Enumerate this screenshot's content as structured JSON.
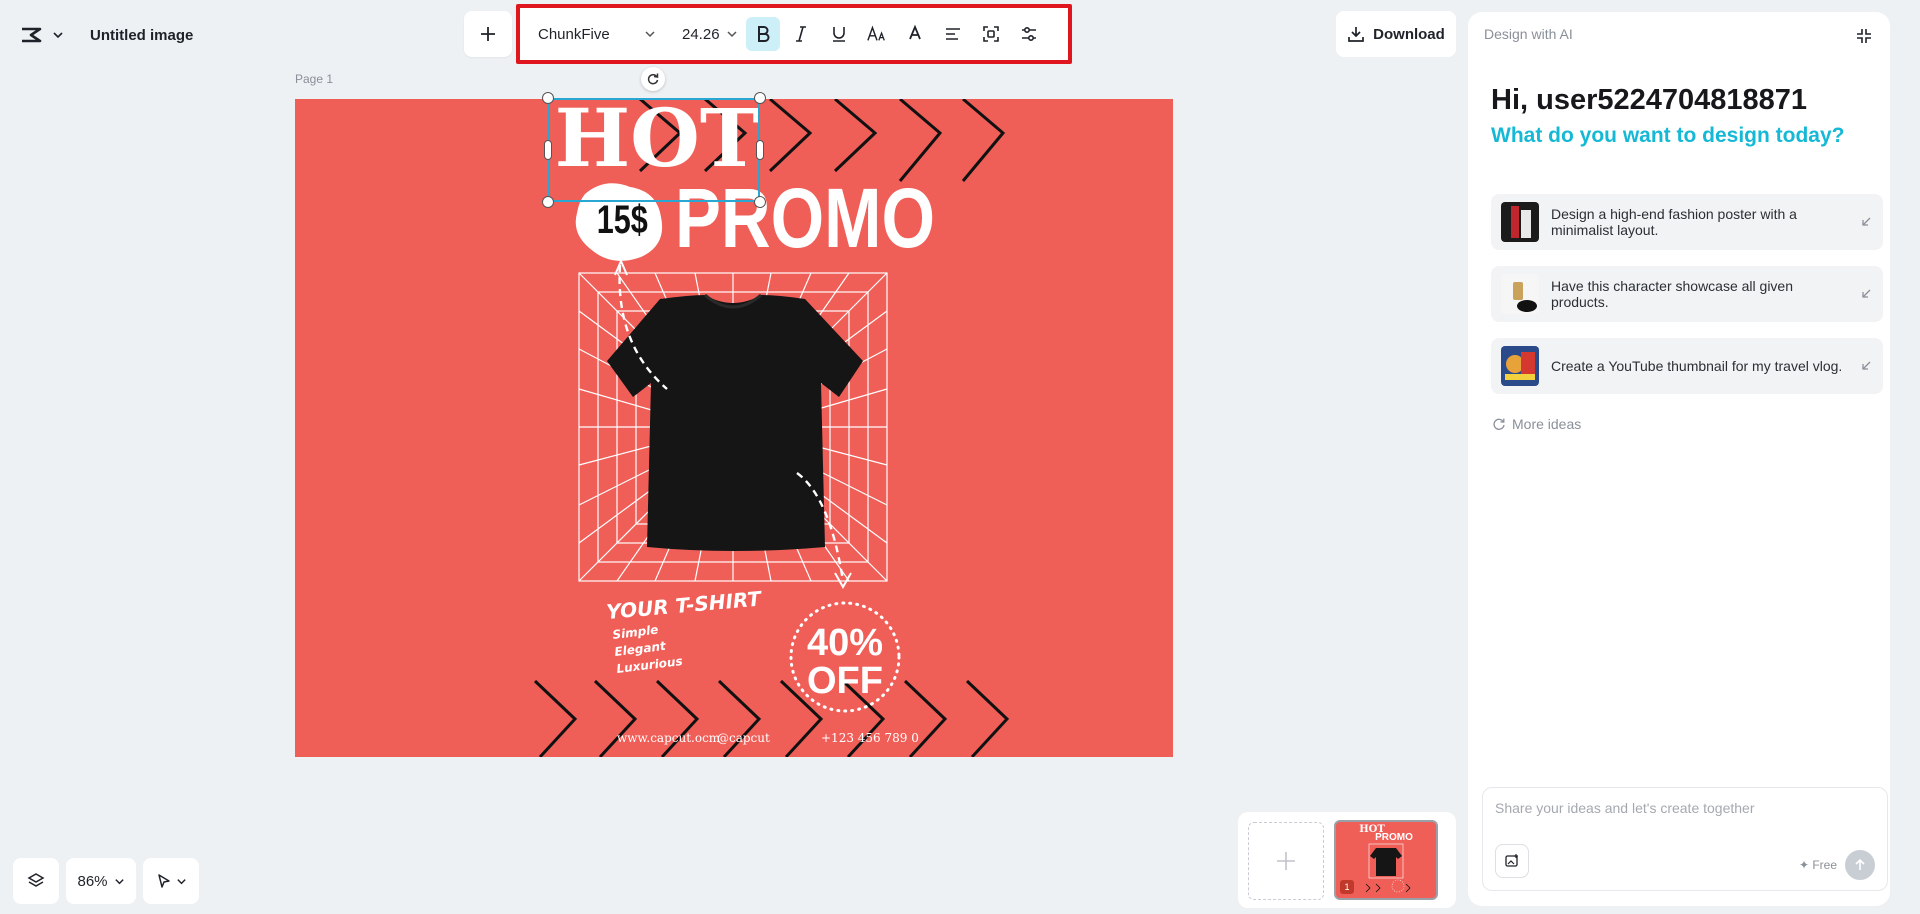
{
  "header": {
    "title": "Untitled image",
    "download_label": "Download"
  },
  "toolbar": {
    "font_name": "ChunkFive",
    "font_size": "24.26",
    "bold_active": true
  },
  "canvas": {
    "page_label": "Page 1",
    "poster": {
      "headline_1": "HOT",
      "headline_2": "PROMO",
      "price_badge": "15$",
      "tagline": "YOUR T-SHIRT",
      "features": [
        "Simple",
        "Elegant",
        "Luxurious"
      ],
      "discount_line_1": "40%",
      "discount_line_2": "OFF",
      "website": "www.capcut.ocm",
      "handle": "@capcut",
      "phone": "+123 456 789 0",
      "background_color": "#f05e58"
    }
  },
  "bottom_controls": {
    "zoom": "86%",
    "page_number": "1"
  },
  "panel": {
    "header": "Design with AI",
    "greeting": "Hi, user5224704818871",
    "subgreeting": "What do you want to design today?",
    "ideas": [
      {
        "text": "Design a high-end fashion poster with a minimalist layout."
      },
      {
        "text": "Have this character showcase all given products."
      },
      {
        "text": "Create a YouTube thumbnail for my travel vlog."
      }
    ],
    "more_ideas": "More ideas",
    "prompt_placeholder": "Share your ideas and let's create together",
    "free_label": "✦ Free"
  },
  "colors": {
    "accent": "#15b9d6",
    "toolbar_highlight": "#e0161f",
    "selection": "#27a7d2"
  }
}
